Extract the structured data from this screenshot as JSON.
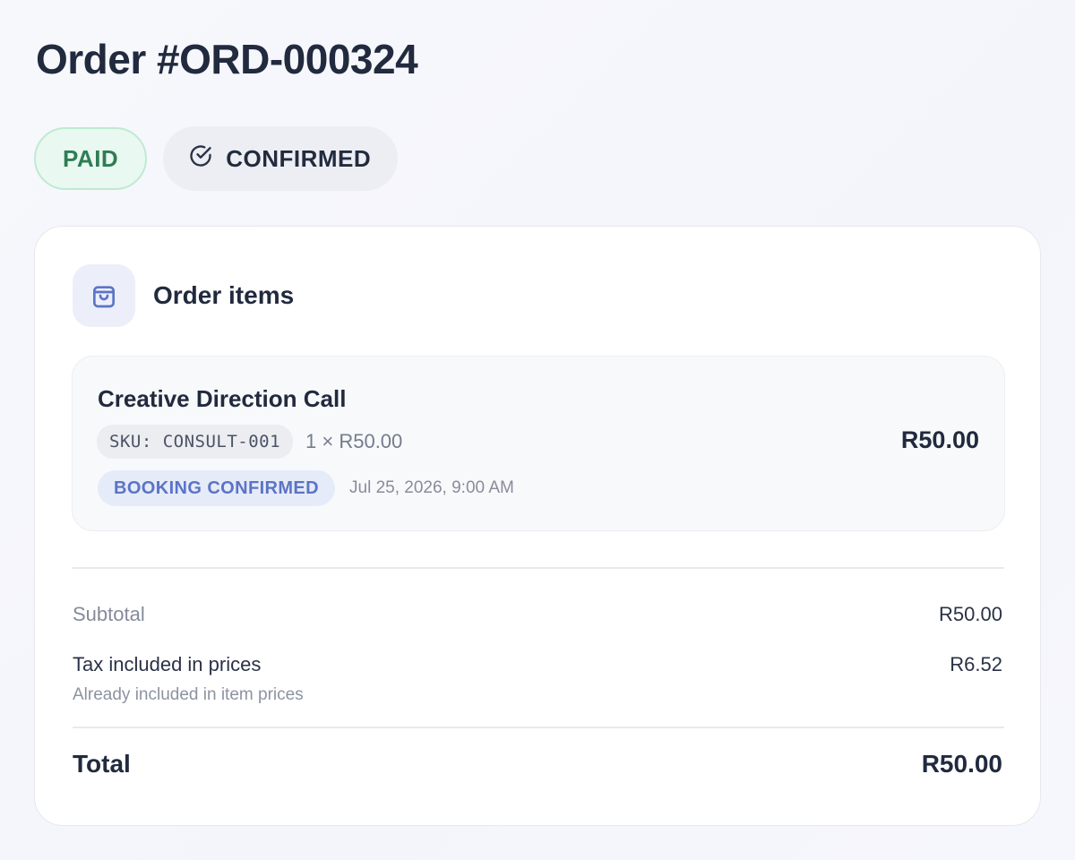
{
  "order": {
    "title": "Order #ORD-000324",
    "payment_status": "PAID",
    "order_status": "CONFIRMED",
    "order_status_icon": "check-circle-icon"
  },
  "items_card": {
    "title": "Order items",
    "icon": "shopping-bag-icon",
    "items": [
      {
        "name": "Creative Direction Call",
        "sku": "SKU: CONSULT-001",
        "quantity_price": "1 × R50.00",
        "booking_status": "BOOKING CONFIRMED",
        "booking_datetime": "Jul 25, 2026, 9:00 AM",
        "line_total": "R50.00"
      }
    ]
  },
  "summary": {
    "subtotal_label": "Subtotal",
    "subtotal_value": "R50.00",
    "tax_label": "Tax included in prices",
    "tax_value": "R6.52",
    "tax_note": "Already included in item prices",
    "total_label": "Total",
    "total_value": "R50.00"
  },
  "colors": {
    "paid_bg": "#e9f8f0",
    "paid_text": "#2e7d55",
    "booking_bg": "#e6ebf9",
    "booking_text": "#5b74c6",
    "icon_accent": "#5b74c6"
  }
}
